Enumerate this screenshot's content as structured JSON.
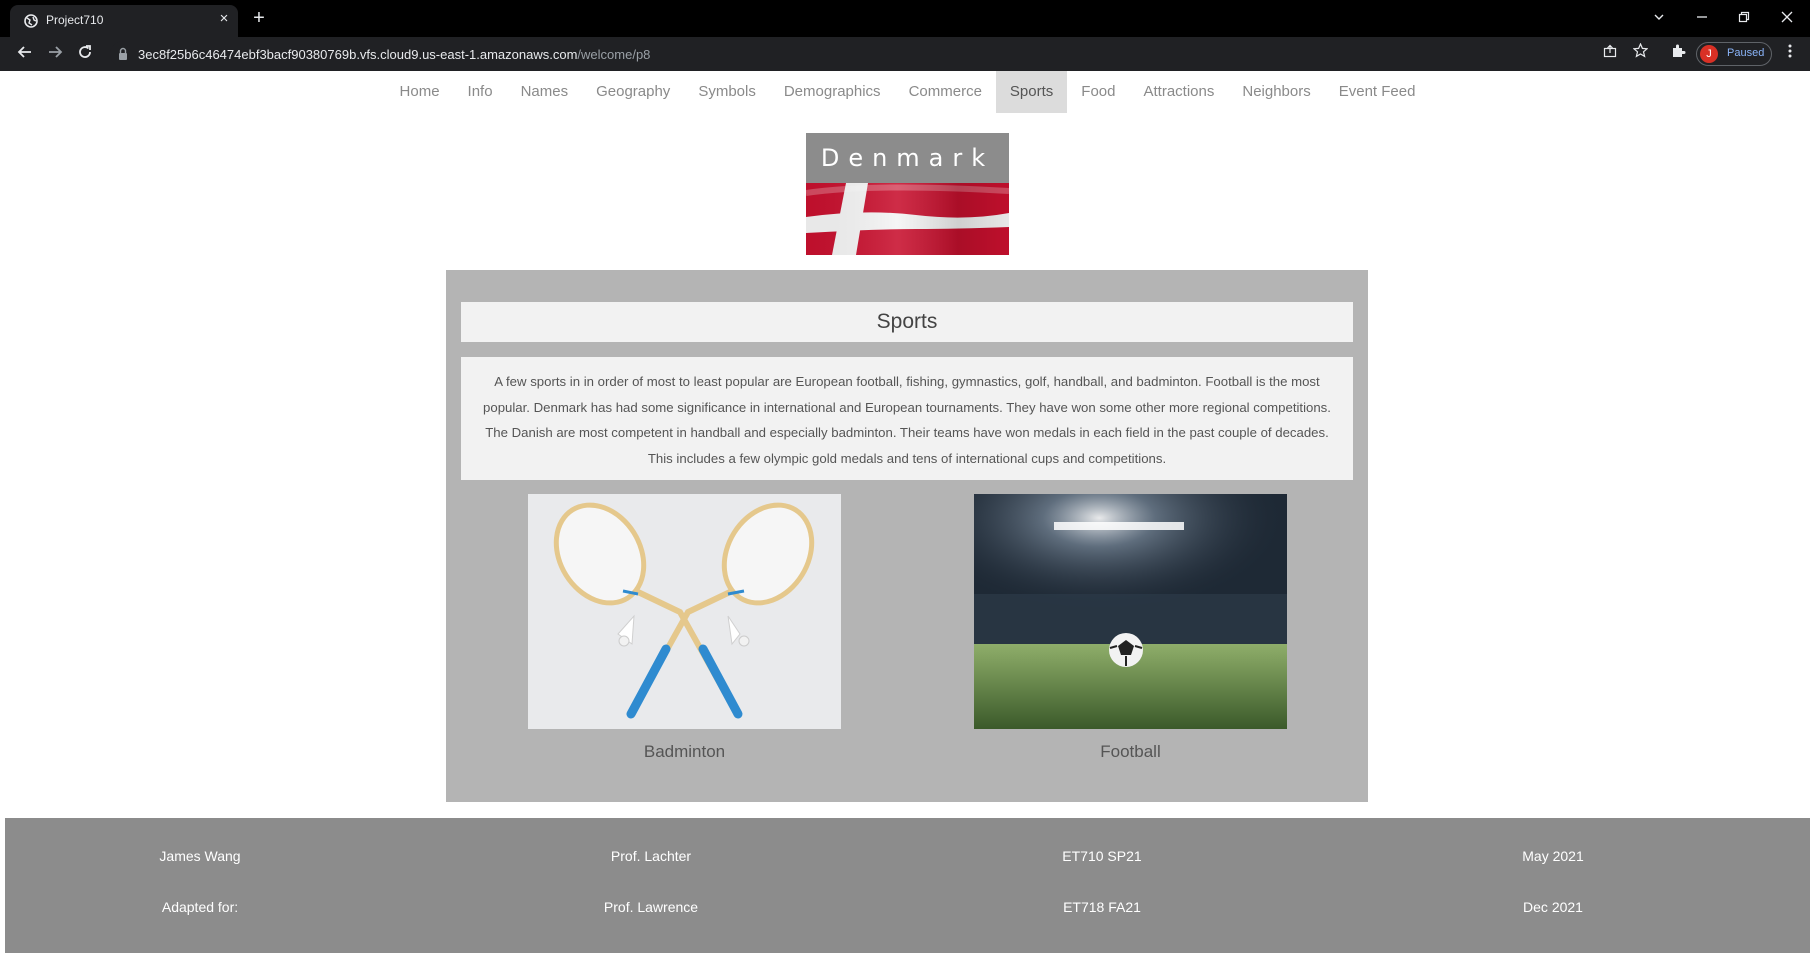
{
  "browser": {
    "tab_title": "Project710",
    "tab_close": "×",
    "new_tab": "+",
    "url_host": "3ec8f25b6c46474ebf3bacf90380769b.vfs.cloud9.us-east-1.amazonaws.com",
    "url_path": "/welcome/p8",
    "profile_initial": "J",
    "profile_status": "Paused",
    "icons": [
      "globe-icon",
      "back-arrow-icon",
      "forward-arrow-icon",
      "reload-icon",
      "lock-icon",
      "share-icon",
      "star-icon",
      "extensions-icon",
      "kebab-menu-icon",
      "chevron-down-icon",
      "minimize-icon",
      "restore-icon",
      "close-icon"
    ]
  },
  "nav": {
    "items": [
      "Home",
      "Info",
      "Names",
      "Geography",
      "Symbols",
      "Demographics",
      "Commerce",
      "Sports",
      "Food",
      "Attractions",
      "Neighbors",
      "Event Feed"
    ],
    "active": "Sports"
  },
  "banner": {
    "country": "Denmark",
    "flag_colors": {
      "red": "#c8102e",
      "white": "#ffffff"
    }
  },
  "section": {
    "title": "Sports",
    "text": "A few sports in in order of most to least popular are European football, fishing, gymnastics, golf, handball, and badminton. Football is the most popular. Denmark has had some significance in international and European tournaments. They have won some other more regional competitions. The Danish are most competent in handball and especially badminton. Their teams have won medals in each field in the past couple of decades. This includes a few olympic gold medals and tens of international cups and competitions."
  },
  "figures": [
    {
      "caption": "Badminton"
    },
    {
      "caption": "Football"
    }
  ],
  "footer": {
    "row1": [
      "James Wang",
      "Prof. Lachter",
      "ET710 SP21",
      "May 2021"
    ],
    "row2": [
      "Adapted for:",
      "Prof. Lawrence",
      "ET718 FA21",
      "Dec 2021"
    ]
  },
  "colors": {
    "panel": "#b4b4b4",
    "footer": "#8c8c8c",
    "active_tab": "#dcdcdc"
  }
}
